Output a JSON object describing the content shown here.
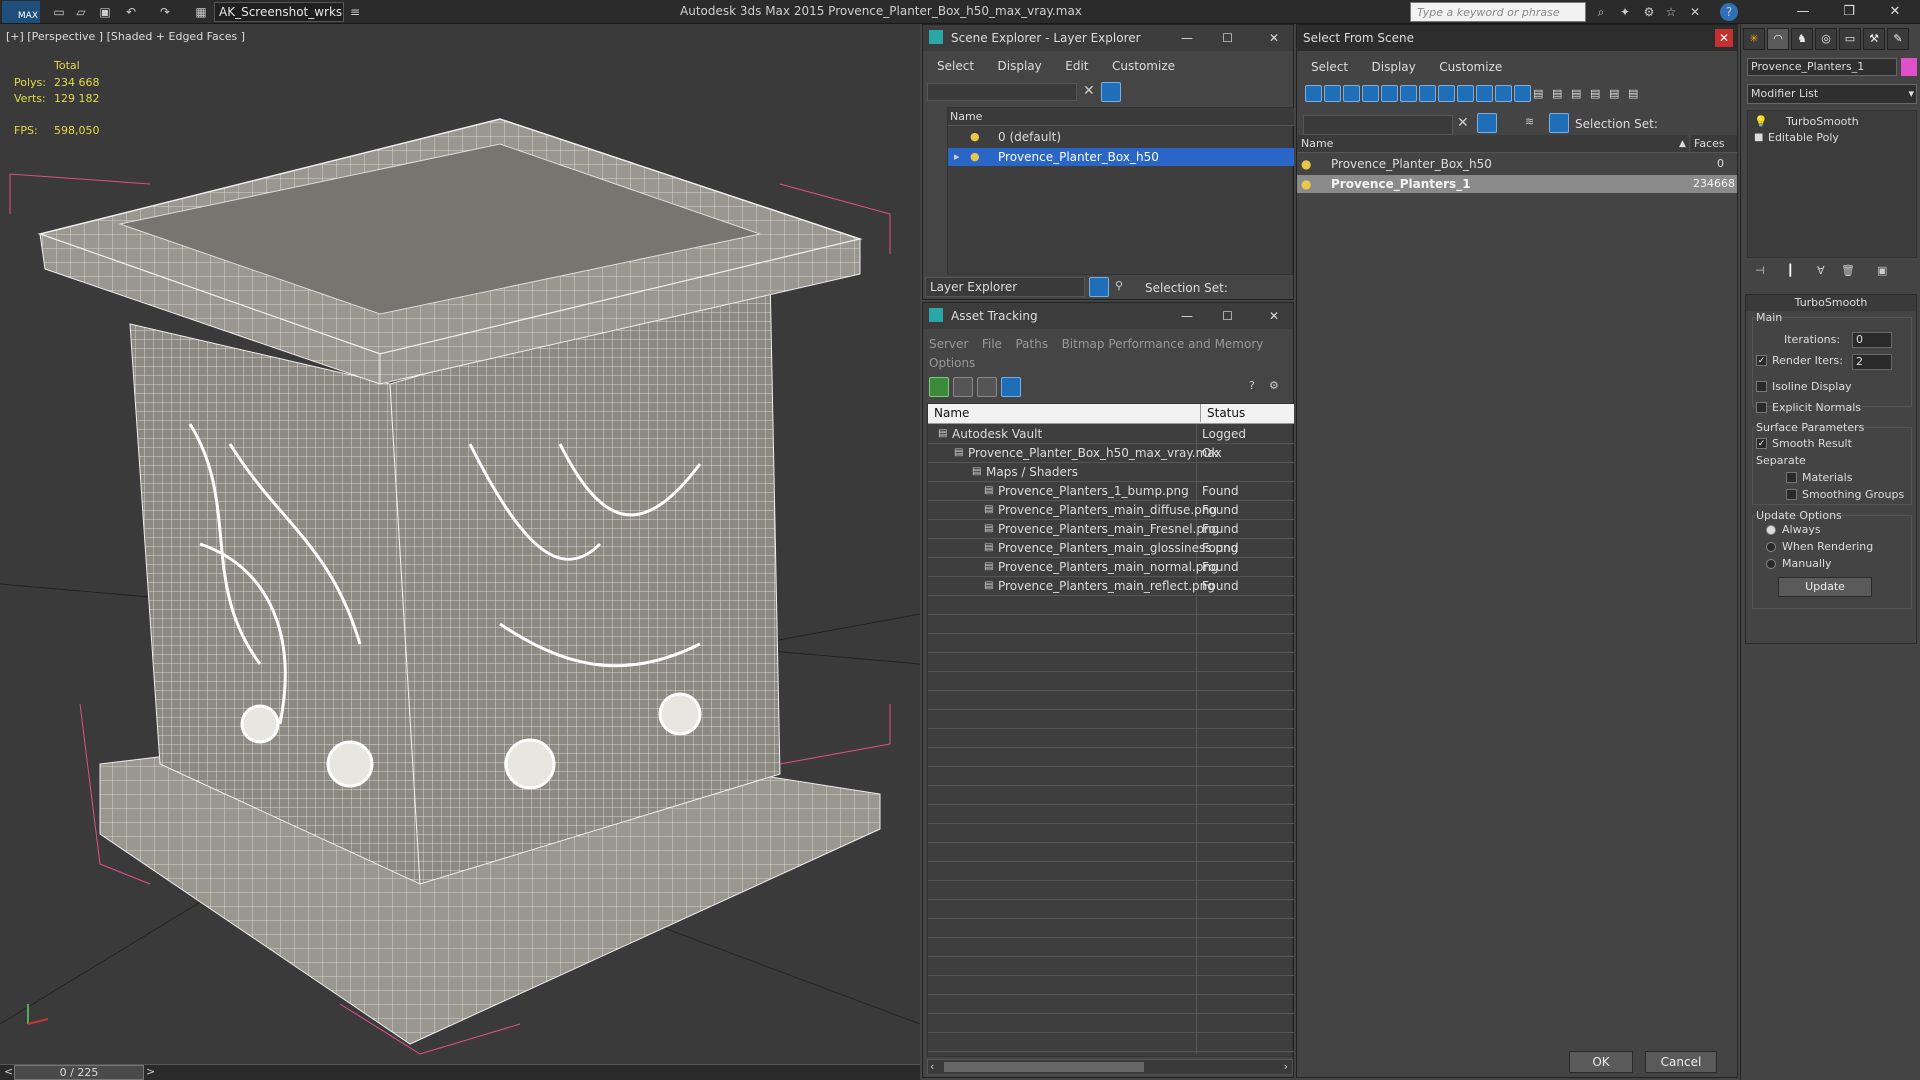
{
  "titlebar": {
    "app_logo": "MAX",
    "workspace": "AK_Screenshot_wrksp",
    "app_title": "Autodesk 3ds Max  2015    Provence_Planter_Box_h50_max_vray.max",
    "search_placeholder": "Type a keyword or phrase"
  },
  "viewport": {
    "label": "[+] [Perspective ] [Shaded + Edged Faces ]",
    "stats": {
      "total_label": "Total",
      "polys_label": "Polys:",
      "polys": "234 668",
      "verts_label": "Verts:",
      "verts": "129 182",
      "fps_label": "FPS:",
      "fps": "598,050"
    },
    "timeline": "0 / 225"
  },
  "scene_explorer": {
    "title": "Scene Explorer - Layer Explorer",
    "menu": [
      "Select",
      "Display",
      "Edit",
      "Customize"
    ],
    "column": "Name",
    "rows": [
      "0 (default)",
      "Provence_Planter_Box_h50"
    ],
    "footer_dropdown": "Layer Explorer",
    "selection_set": "Selection Set:"
  },
  "asset_tracking": {
    "title": "Asset Tracking",
    "menu": [
      "Server",
      "File",
      "Paths",
      "Bitmap Performance and Memory",
      "Options"
    ],
    "col_name": "Name",
    "col_status": "Status",
    "rows": [
      {
        "name": "Autodesk Vault",
        "status": "Logged"
      },
      {
        "name": "Provence_Planter_Box_h50_max_vray.max",
        "status": "Ok"
      },
      {
        "name": "Maps / Shaders",
        "status": ""
      },
      {
        "name": "Provence_Planters_1_bump.png",
        "status": "Found"
      },
      {
        "name": "Provence_Planters_main_diffuse.png",
        "status": "Found"
      },
      {
        "name": "Provence_Planters_main_Fresnel.png",
        "status": "Found"
      },
      {
        "name": "Provence_Planters_main_glossiness.png",
        "status": "Found"
      },
      {
        "name": "Provence_Planters_main_normal.png",
        "status": "Found"
      },
      {
        "name": "Provence_Planters_main_reflect.png",
        "status": "Found"
      }
    ]
  },
  "select_from_scene": {
    "title": "Select From Scene",
    "menu": [
      "Select",
      "Display",
      "Customize"
    ],
    "selection_set": "Selection Set:",
    "col_name": "Name",
    "col_faces": "Faces",
    "rows": [
      {
        "name": "Provence_Planter_Box_h50",
        "faces": "0"
      },
      {
        "name": "Provence_Planters_1",
        "faces": "234668"
      }
    ],
    "ok": "OK",
    "cancel": "Cancel"
  },
  "command_panel": {
    "object_name": "Provence_Planters_1",
    "modifier_list": "Modifier List",
    "stack": [
      "TurboSmooth",
      "Editable Poly"
    ],
    "rollout_title": "TurboSmooth",
    "main_label": "Main",
    "iterations_label": "Iterations:",
    "iterations": "0",
    "render_iters_label": "Render Iters:",
    "render_iters": "2",
    "isoline": "Isoline Display",
    "explicit_normals": "Explicit Normals",
    "surface_params": "Surface Parameters",
    "smooth_result": "Smooth Result",
    "separate": "Separate",
    "materials": "Materials",
    "smoothing_groups": "Smoothing Groups",
    "update_options": "Update Options",
    "always": "Always",
    "when_rendering": "When Rendering",
    "manually": "Manually",
    "update": "Update"
  }
}
